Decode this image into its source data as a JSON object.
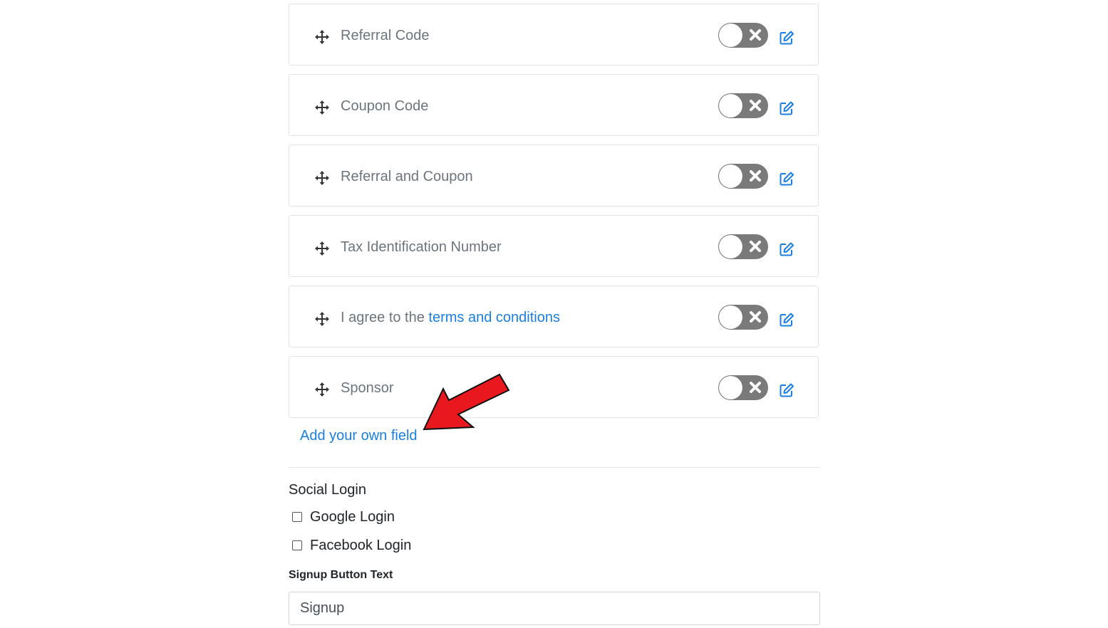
{
  "fields": [
    {
      "label": "Referral Code",
      "enabled": false
    },
    {
      "label": "Coupon Code",
      "enabled": false
    },
    {
      "label": "Referral and Coupon",
      "enabled": false
    },
    {
      "label": "Tax Identification Number",
      "enabled": false
    },
    {
      "label_prefix": "I agree to the ",
      "label_link": "terms and conditions",
      "enabled": false
    },
    {
      "label": "Sponsor",
      "enabled": false
    }
  ],
  "add_field_link": "Add your own field",
  "social_login": {
    "title": "Social Login",
    "options": [
      {
        "label": "Google Login",
        "checked": false
      },
      {
        "label": "Facebook Login",
        "checked": false
      }
    ]
  },
  "signup_button": {
    "label": "Signup Button Text",
    "value": "Signup"
  },
  "colors": {
    "accent": "#1a7fe0",
    "toggle_off": "#7a7a7a",
    "annotation_arrow": "#e8181e"
  },
  "icons": {
    "drag": "move-icon",
    "toggle_off": "close-icon",
    "edit": "edit-icon"
  }
}
